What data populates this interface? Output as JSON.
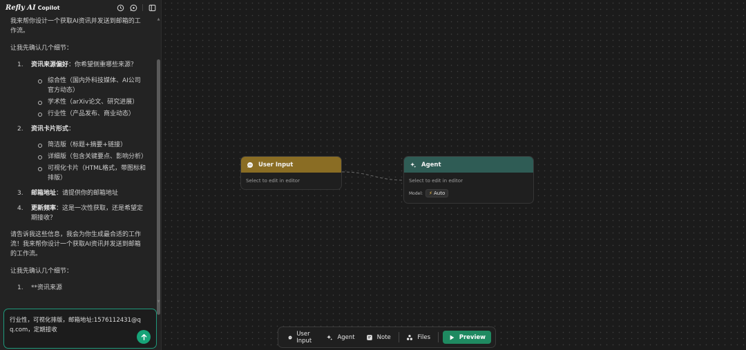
{
  "app": {
    "brand": "Refly AI",
    "brand_sub": "Copilot"
  },
  "header_icons": [
    "history-icon",
    "new-chat-icon",
    "sidebar-toggle-icon"
  ],
  "chat": {
    "intro": "我来帮你设计一个获取AI资讯并发送到邮箱的工作流。",
    "confirm": "让我先确认几个细节：",
    "items": [
      {
        "num": "1.",
        "title": "资讯来源偏好",
        "text": "：你希望侧重哪些来源？",
        "subs": [
          "综合性（国内外科技媒体、AI公司官方动态）",
          "学术性（arXiv论文、研究进展）",
          "行业性（产品发布、商业动态）"
        ]
      },
      {
        "num": "2.",
        "title": "资讯卡片形式",
        "text": "：",
        "subs": [
          "简洁版（标题+摘要+链接）",
          "详细版（包含关键要点、影响分析）",
          "可视化卡片（HTML格式，带图标和排版）"
        ]
      },
      {
        "num": "3.",
        "title": "邮箱地址",
        "text": "：请提供你的邮箱地址",
        "subs": []
      },
      {
        "num": "4.",
        "title": "更新频率",
        "text": "：这是一次性获取，还是希望定期接收？",
        "subs": []
      }
    ],
    "closing": "请告诉我这些信息，我会为你生成最合适的工作流！我来帮你设计一个获取AI资讯并发送到邮箱的工作流。",
    "confirm2": "让我先确认几个细节：",
    "partial_item": {
      "num": "1.",
      "text": "**资讯来源"
    }
  },
  "composer": {
    "value": "行业性，可视化排版，邮箱地址:1576112431@qq.com，定期接收"
  },
  "canvas": {
    "user_input_node": {
      "title": "User Input",
      "hint": "Select to edit in editor",
      "color": "#8a6d24"
    },
    "agent_node": {
      "title": "Agent",
      "hint": "Select to edit in editor",
      "model_label": "Model:",
      "model_value": "Auto",
      "color": "#2f5c55"
    }
  },
  "toolbar": {
    "user_input": "User Input",
    "agent": "Agent",
    "note": "Note",
    "files": "Files",
    "preview": "Preview"
  },
  "colors": {
    "accent": "#17a378",
    "preview_bg": "#1f8a61",
    "user_input_header": "#8a6d24",
    "agent_header": "#2f5c55"
  }
}
